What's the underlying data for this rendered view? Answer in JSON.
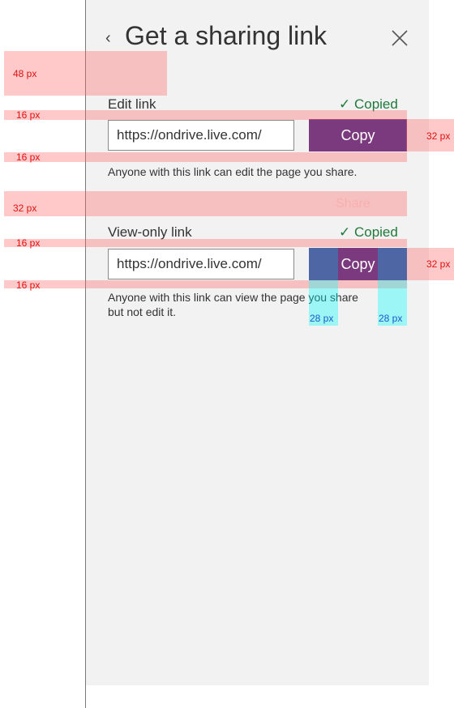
{
  "header": {
    "back_glyph": "‹",
    "title": "Get a sharing link",
    "close_icon": "close-icon"
  },
  "edit_section": {
    "label": "Edit link",
    "status": "✓ Copied",
    "url": "https://ondrive.live.com/",
    "button": "Copy",
    "description": "Anyone with this link can edit the page you share."
  },
  "share_button": {
    "label": "Share"
  },
  "view_section": {
    "label": "View-only link",
    "status": "✓ Copied",
    "url": "https://ondrive.live.com/",
    "button": "Copy",
    "description": "Anyone with this link can view the page you share but not edit it."
  },
  "annotations": {
    "a48": "48 px",
    "a16_1": "16 px",
    "a16_2": "16 px",
    "a32_share": "32 px",
    "a16_3": "16 px",
    "a16_4": "16 px",
    "a32_btn1": "32 px",
    "a32_btn2": "32 px",
    "a28_left": "28 px",
    "a28_right": "28 px"
  },
  "colors": {
    "accent_purple": "#7b3a7e",
    "success_green": "#1f7a3c",
    "panel_bg": "#f2f2f2",
    "annotation_red": "#e01010",
    "annotation_cyan": "#00ffff"
  }
}
